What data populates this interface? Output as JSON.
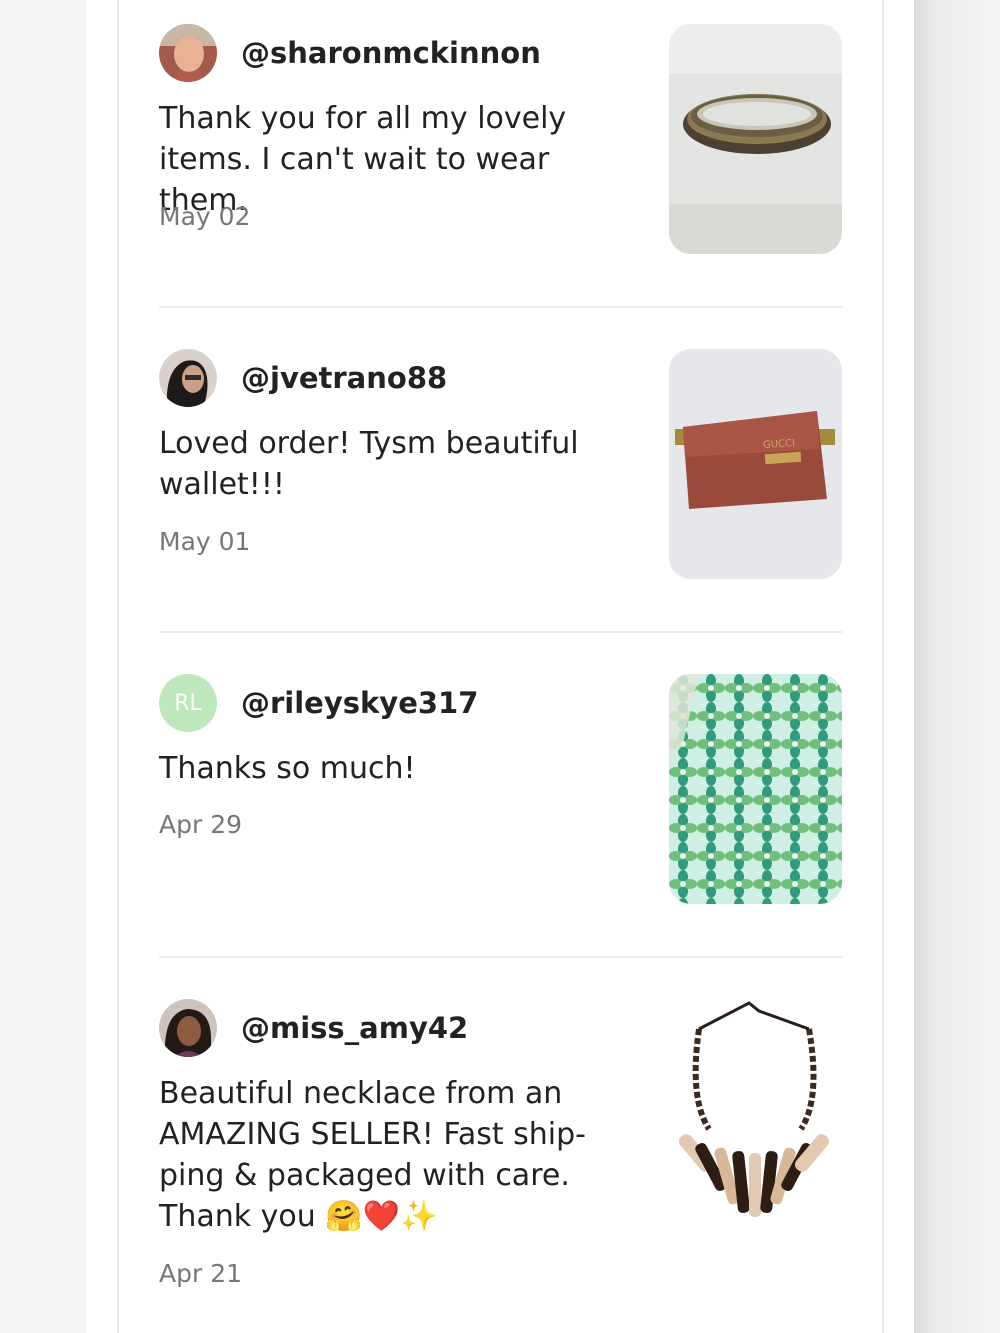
{
  "reviews": [
    {
      "username": "@sharonmckinnon",
      "text_lines": [
        "Thank you for all my lovely",
        "items. I can't wait to wear them."
      ],
      "date": "May 02",
      "avatar_icon": "person-avatar-photo",
      "thumb_icon": "bangles-photo"
    },
    {
      "username": "@jvetrano88",
      "text_lines": [
        "Loved order! Tysm beautiful",
        "wallet!!!"
      ],
      "date": "May 01",
      "avatar_icon": "person-avatar-photo",
      "thumb_icon": "wallet-photo",
      "thumb_brand": "GUCCI"
    },
    {
      "username": "@rileyskye317",
      "text_lines": [
        "Thanks so much!"
      ],
      "date": "Apr 29",
      "avatar_initials": "RL",
      "thumb_icon": "patterned-fabric-photo"
    },
    {
      "username": "@miss_amy42",
      "text_lines": [
        "Beautiful necklace from an",
        "AMAZING SELLER! Fast ship-",
        "ping & packaged with care.",
        "Thank you 🤗❤️✨"
      ],
      "date": "Apr 21",
      "avatar_icon": "person-avatar-photo",
      "thumb_icon": "necklace-photo"
    }
  ],
  "colors": {
    "username": "#222222",
    "text": "#222222",
    "date": "#777777",
    "divider": "#ececec",
    "initials_avatar_bg": "#bfe7bd"
  }
}
